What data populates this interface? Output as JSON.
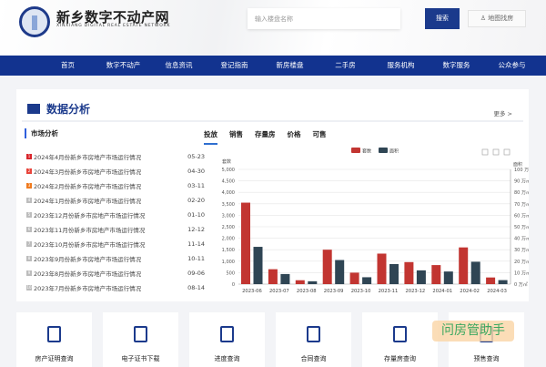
{
  "header": {
    "title": "新乡数字不动产网",
    "subtitle": "XINXIANG DIGITAL REAL ESTATE NETWORK",
    "search_placeholder": "输入楼盘名称",
    "search_label": "搜索",
    "map_label": "地图找房"
  },
  "nav": [
    "首页",
    "数字不动产",
    "信息资讯",
    "登记指南",
    "新房楼盘",
    "二手房",
    "服务机构",
    "数字服务",
    "公众参与"
  ],
  "panel": {
    "title": "数据分析",
    "more": "更多 >",
    "subtitle": "市场分析"
  },
  "list": [
    {
      "n": "1",
      "t": "2024年4月份新乡市房地产市场运行情况",
      "d": "05-23",
      "c": "#d9262c"
    },
    {
      "n": "2",
      "t": "2024年3月份新乡市房地产市场运行情况",
      "d": "04-30",
      "c": "#e8453c"
    },
    {
      "n": "3",
      "t": "2024年2月份新乡市房地产市场运行情况",
      "d": "03-11",
      "c": "#f07b1f"
    },
    {
      "n": "4",
      "t": "2024年1月份新乡市房地产市场运行情况",
      "d": "02-20",
      "c": "#bdbdbd"
    },
    {
      "n": "5",
      "t": "2023年12月份新乡市房地产市场运行情况",
      "d": "01-10",
      "c": "#bdbdbd"
    },
    {
      "n": "6",
      "t": "2023年11月份新乡市房地产市场运行情况",
      "d": "12-12",
      "c": "#bdbdbd"
    },
    {
      "n": "7",
      "t": "2023年10月份新乡市房地产市场运行情况",
      "d": "11-14",
      "c": "#bdbdbd"
    },
    {
      "n": "8",
      "t": "2023年9月份新乡市房地产市场运行情况",
      "d": "10-11",
      "c": "#bdbdbd"
    },
    {
      "n": "9",
      "t": "2023年8月份新乡市房地产市场运行情况",
      "d": "09-06",
      "c": "#bdbdbd"
    },
    {
      "n": "10",
      "t": "2023年7月份新乡市房地产市场运行情况",
      "d": "08-14",
      "c": "#bdbdbd"
    }
  ],
  "tabs": [
    "投放",
    "销售",
    "存量房",
    "价格",
    "可售"
  ],
  "chart_data": {
    "type": "bar",
    "categories": [
      "2023-06",
      "2023-07",
      "2023-08",
      "2023-09",
      "2023-10",
      "2023-11",
      "2023-12",
      "2024-01",
      "2024-02",
      "2024-03"
    ],
    "series": [
      {
        "name": "套数",
        "axis": "left",
        "color": "#c23531",
        "values": [
          3550,
          650,
          170,
          1500,
          500,
          1330,
          960,
          830,
          1600,
          290
        ]
      },
      {
        "name": "面积",
        "axis": "right",
        "color": "#2f4554",
        "values": [
          32.5,
          8.8,
          2.5,
          21,
          6,
          17.5,
          12,
          11,
          19.5,
          3.5
        ]
      }
    ],
    "ylabel": "套数",
    "y2label": "面积",
    "ylim": [
      0,
      5000
    ],
    "y2lim": [
      0,
      100
    ],
    "yticks": [
      "0",
      "500",
      "1,000",
      "1,500",
      "2,000",
      "2,500",
      "3,000",
      "3,500",
      "4,000",
      "4,500",
      "5,000"
    ],
    "y2ticks": [
      "0 万㎡",
      "10 万㎡",
      "20 万㎡",
      "30 万㎡",
      "40 万㎡",
      "50 万㎡",
      "60 万㎡",
      "70 万㎡",
      "80 万㎡",
      "90 万㎡",
      "100 万㎡"
    ],
    "legend": "top-center",
    "grid": true
  },
  "cards": [
    "房产证明查询",
    "电子证书下载",
    "进度查询",
    "合同查询",
    "存量房查询",
    "预售查询"
  ],
  "watermark": "问房管助手"
}
